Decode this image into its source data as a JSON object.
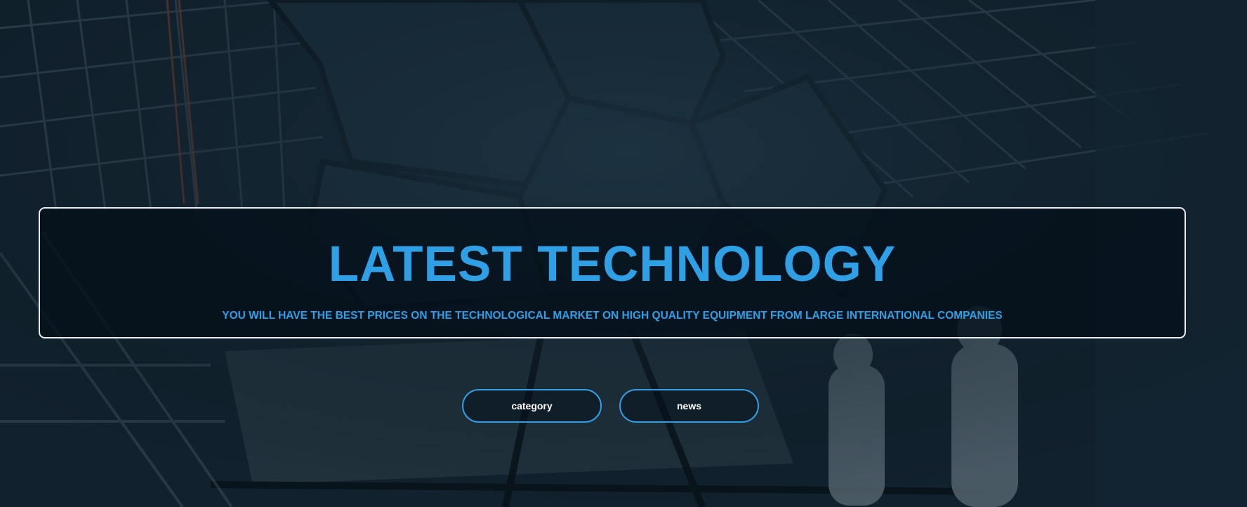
{
  "hero": {
    "title": "LATEST TECHNOLOGY",
    "subtitle": "YOU WILL HAVE THE BEST PRICES ON THE TECHNOLOGICAL MARKET ON HIGH QUALITY EQUIPMENT FROM LARGE INTERNATIONAL COMPANIES",
    "accent_color": "#2f9fe6",
    "border_color": "#e9eef2"
  },
  "buttons": {
    "category_label": "category",
    "news_label": "news"
  }
}
